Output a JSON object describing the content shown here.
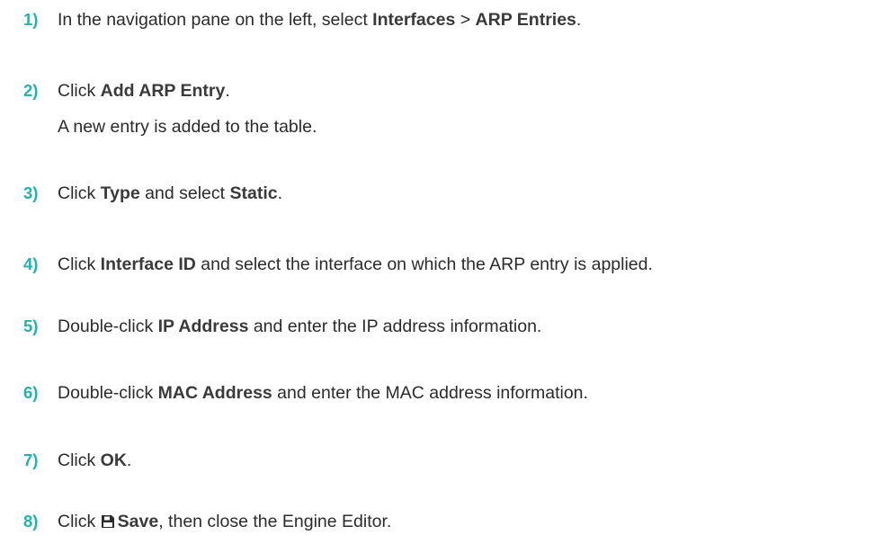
{
  "steps": [
    {
      "number": "1)",
      "parts": [
        {
          "t": "In the navigation pane on the left, select "
        },
        {
          "t": "Interfaces",
          "b": true
        },
        {
          "t": " > "
        },
        {
          "t": "ARP Entries",
          "b": true
        },
        {
          "t": "."
        }
      ]
    },
    {
      "number": "2)",
      "parts": [
        {
          "t": "Click "
        },
        {
          "t": "Add ARP Entry",
          "b": true
        },
        {
          "t": "."
        }
      ],
      "result": "A new entry is added to the table."
    },
    {
      "number": "3)",
      "parts": [
        {
          "t": "Click "
        },
        {
          "t": "Type",
          "b": true
        },
        {
          "t": " and select "
        },
        {
          "t": "Static",
          "b": true
        },
        {
          "t": "."
        }
      ]
    },
    {
      "number": "4)",
      "parts": [
        {
          "t": "Click "
        },
        {
          "t": "Interface ID",
          "b": true
        },
        {
          "t": " and select the interface on which the ARP entry is applied."
        }
      ]
    },
    {
      "number": "5)",
      "parts": [
        {
          "t": "Double-click "
        },
        {
          "t": "IP Address",
          "b": true
        },
        {
          "t": " and enter the IP address information."
        }
      ]
    },
    {
      "number": "6)",
      "parts": [
        {
          "t": "Double-click "
        },
        {
          "t": "MAC Address",
          "b": true
        },
        {
          "t": " and enter the MAC address information."
        }
      ]
    },
    {
      "number": "7)",
      "parts": [
        {
          "t": "Click "
        },
        {
          "t": "OK",
          "b": true
        },
        {
          "t": "."
        }
      ]
    },
    {
      "number": "8)",
      "parts": [
        {
          "t": "Click "
        },
        {
          "icon": "save-icon"
        },
        {
          "t": "Save",
          "b": true
        },
        {
          "t": ", then close the Engine Editor."
        }
      ]
    }
  ]
}
